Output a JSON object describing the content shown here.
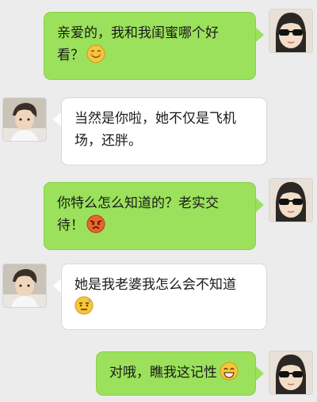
{
  "messages": [
    {
      "side": "me",
      "text": "亲爱的，我和我闺蜜哪个好看？",
      "emoji_icon": "smiling-face-emoji-icon"
    },
    {
      "side": "other",
      "text": "当然是你啦，她不仅是飞机场，还胖。"
    },
    {
      "side": "me",
      "text": "你特么怎么知道的？老实交待！",
      "emoji_icon": "angry-face-emoji-icon"
    },
    {
      "side": "other",
      "text": "她是我老婆我怎么会不知道",
      "emoji_icon": "sweating-face-emoji-icon"
    },
    {
      "side": "me",
      "text": "对哦，瞧我这记性",
      "emoji_icon": "grinning-face-emoji-icon"
    }
  ],
  "colors": {
    "background": "#ececec",
    "my_bubble": "#9be15b",
    "other_bubble": "#ffffff"
  },
  "avatars": {
    "me": "girl-with-sunglasses-avatar",
    "other": "boy-avatar"
  }
}
